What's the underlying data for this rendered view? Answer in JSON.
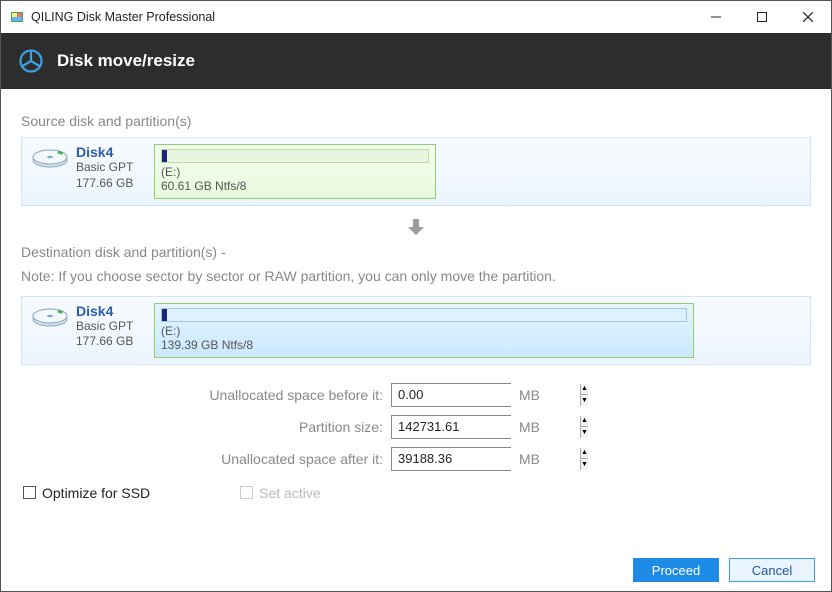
{
  "titlebar": {
    "app_title": "QILING Disk Master Professional"
  },
  "header": {
    "page_title": "Disk move/resize"
  },
  "source": {
    "section_label": "Source disk and partition(s)",
    "disk_name": "Disk4",
    "disk_type": "Basic GPT",
    "disk_size": "177.66 GB",
    "partition": {
      "drive": "(E:)",
      "desc": "60.61 GB Ntfs/8",
      "fill_pct": 2
    }
  },
  "destination": {
    "section_label": "Destination disk and partition(s) -",
    "note": "Note: If you choose sector by sector or RAW partition, you can only move the partition.",
    "disk_name": "Disk4",
    "disk_type": "Basic GPT",
    "disk_size": "177.66 GB",
    "partition": {
      "drive": "(E:)",
      "desc": "139.39 GB Ntfs/8",
      "fill_pct": 1
    }
  },
  "fields": {
    "unalloc_before_label": "Unallocated space before it:",
    "unalloc_before_value": "0.00",
    "partition_size_label": "Partition size:",
    "partition_size_value": "142731.61",
    "unalloc_after_label": "Unallocated space after it:",
    "unalloc_after_value": "39188.36",
    "unit": "MB"
  },
  "options": {
    "optimize_ssd": "Optimize for SSD",
    "set_active": "Set active"
  },
  "footer": {
    "proceed": "Proceed",
    "cancel": "Cancel"
  }
}
